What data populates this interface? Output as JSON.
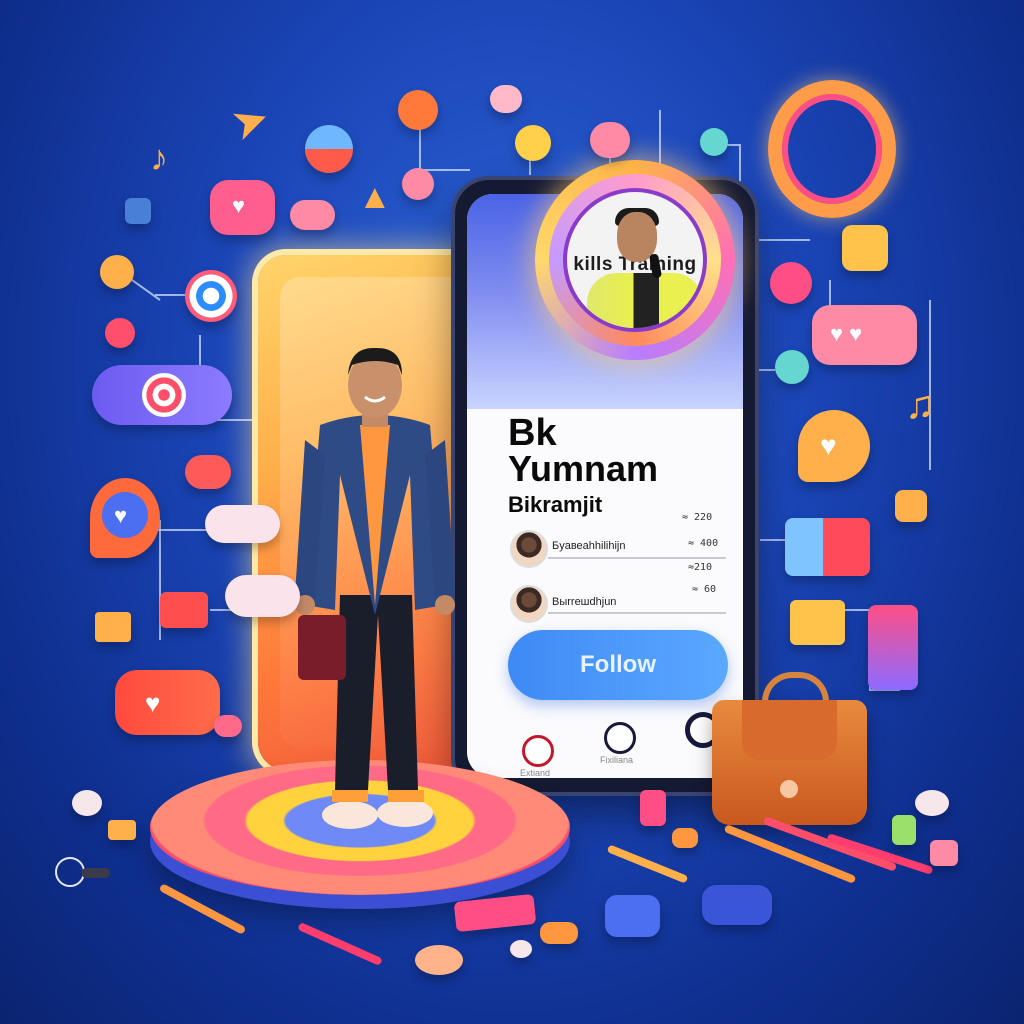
{
  "profile": {
    "photo_caption": "kills Training",
    "name_line1": "Bk",
    "name_line2": "Yumnam",
    "name_line3": "Bikramjit"
  },
  "stats": {
    "top_value": "≈ 𝟸𝟸𝟶",
    "row1_value": "≈𝟸𝟷𝟶"
  },
  "suggestions": [
    {
      "name": "Бyавеаhhilihijn",
      "value": "≈ 𝟺𝟶𝟶"
    },
    {
      "name": "Bыrrешdhjun",
      "value": "≈ 𝟼𝟶"
    }
  ],
  "follow_button": {
    "label": "Follow"
  },
  "bottom_nav": [
    {
      "icon": "record-icon",
      "label": "Extiand"
    },
    {
      "icon": "camera-icon",
      "label": "Fixiliana"
    },
    {
      "icon": "lens-icon",
      "label": ""
    }
  ],
  "colors": {
    "background": "#1b46b8",
    "accent": "#3e8af5",
    "panel": "#ffb04a"
  },
  "decor_icons": [
    "heart-bubble-icon",
    "target-icon",
    "music-note-icon",
    "paper-plane-icon",
    "envelope-icon",
    "cloud-icon",
    "gift-icon",
    "like-bubble-icon",
    "ring-icon",
    "handbag-icon",
    "pencil-icon"
  ]
}
